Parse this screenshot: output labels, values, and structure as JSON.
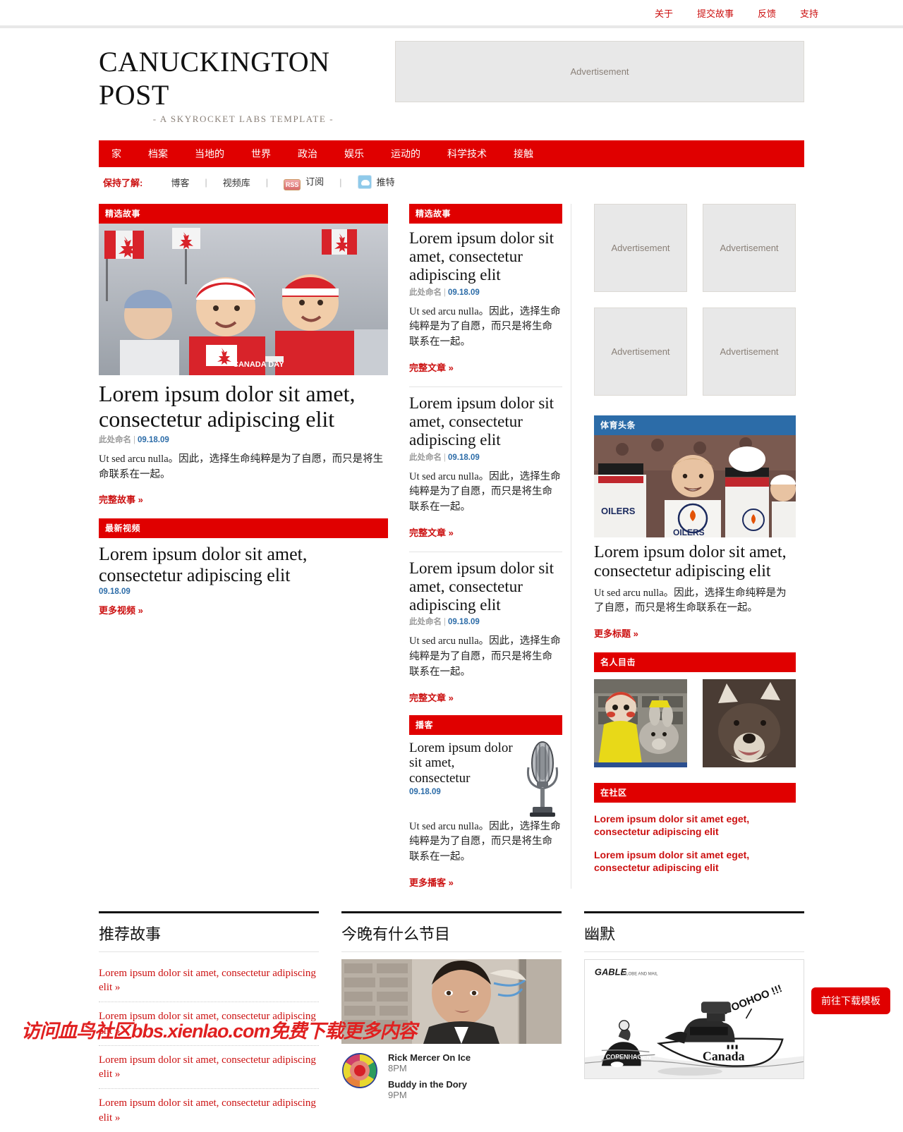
{
  "topnav": {
    "items": [
      {
        "label": "关于"
      },
      {
        "label": "提交故事"
      },
      {
        "label": "反馈"
      },
      {
        "label": "支持"
      }
    ]
  },
  "masthead": {
    "title": "CANUCKINGTON POST",
    "tagline": "- A SKYROCKET LABS TEMPLATE -",
    "banner_ad": "Advertisement"
  },
  "mainnav": {
    "items": [
      {
        "label": "家"
      },
      {
        "label": "档案"
      },
      {
        "label": "当地的"
      },
      {
        "label": "世界"
      },
      {
        "label": "政治"
      },
      {
        "label": "娱乐"
      },
      {
        "label": "运动的"
      },
      {
        "label": "科学技术"
      },
      {
        "label": "接触"
      }
    ]
  },
  "subbar": {
    "label": "保持了解:",
    "blog": "博客",
    "video_library": "视频库",
    "rss_icon_label": "RSS",
    "subscribe": "订阅",
    "twitter": "推特",
    "separator": "|"
  },
  "left": {
    "featured_header": "精选故事",
    "featured": {
      "title": "Lorem ipsum dolor sit amet, consectetur adipiscing elit",
      "author": "此处命名",
      "date": "09.18.09",
      "body": "Ut sed arcu nulla。因此，选择生命纯粹是为了自愿，而只是将生命联系在一起。",
      "more": "完整故事 »",
      "photo_alt": "canada-day-children-photo"
    },
    "video_header": "最新视频",
    "video": {
      "title": "Lorem ipsum dolor sit amet, consectetur adipiscing elit",
      "date": "09.18.09",
      "more": "更多视频 »"
    }
  },
  "middle": {
    "featured_header": "精选故事",
    "articles": [
      {
        "title": "Lorem ipsum dolor sit amet, consectetur adipiscing elit",
        "author": "此处命名",
        "date": "09.18.09",
        "body": "Ut sed arcu nulla。因此，选择生命纯粹是为了自愿，而只是将生命联系在一起。",
        "more": "完整文章 »"
      },
      {
        "title": "Lorem ipsum dolor sit amet, consectetur adipiscing elit",
        "author": "此处命名",
        "date": "09.18.09",
        "body": "Ut sed arcu nulla。因此，选择生命纯粹是为了自愿，而只是将生命联系在一起。",
        "more": "完整文章 »"
      },
      {
        "title": "Lorem ipsum dolor sit amet, consectetur adipiscing elit",
        "author": "此处命名",
        "date": "09.18.09",
        "body": "Ut sed arcu nulla。因此，选择生命纯粹是为了自愿，而只是将生命联系在一起。",
        "more": "完整文章 »"
      }
    ],
    "podcast_header": "播客",
    "podcast": {
      "title": "Lorem ipsum dolor sit amet, consectetur",
      "date": "09.18.09",
      "body": "Ut sed arcu nulla。因此，选择生命纯粹是为了自愿，而只是将生命联系在一起。",
      "more": "更多播客 »",
      "icon_alt": "microphone-image"
    }
  },
  "right": {
    "ads": [
      {
        "label": "Advertisement"
      },
      {
        "label": "Advertisement"
      },
      {
        "label": "Advertisement"
      },
      {
        "label": "Advertisement"
      }
    ],
    "sports_header": "体育头条",
    "sports": {
      "title": "Lorem ipsum dolor sit amet, consectetur adipiscing elit",
      "body": "Ut sed arcu nulla。因此，选择生命纯粹是为了自愿，而只是将生命联系在一起。",
      "more": "更多标题 »",
      "photo_alt": "hockey-celebration-photo"
    },
    "celeb_header": "名人目击",
    "celebs": [
      {
        "alt": "celebrity-photo-costumes"
      },
      {
        "alt": "celebrity-photo-dog"
      }
    ],
    "community_header": "在社区",
    "community_links": [
      {
        "label": "Lorem ipsum dolor sit amet eget, consectetur adipiscing elit"
      },
      {
        "label": "Lorem ipsum dolor sit amet eget, consectetur adipiscing elit"
      }
    ]
  },
  "footer": {
    "recommended_header": "推荐故事",
    "recommended_links": [
      {
        "label": "Lorem ipsum dolor sit amet, consectetur adipiscing elit »"
      },
      {
        "label": "Lorem ipsum dolor sit amet, consectetur adipiscing elit »"
      },
      {
        "label": "Lorem ipsum dolor sit amet, consectetur adipiscing elit »"
      },
      {
        "label": "Lorem ipsum dolor sit amet, consectetur adipiscing elit »"
      }
    ],
    "tonight_header": "今晚有什么节目",
    "tonight_photo_alt": "rick-mercer-photo",
    "tonight_logo_alt": "cbc-logo",
    "shows": [
      {
        "title": "Rick Mercer On Ice",
        "time": "8PM"
      },
      {
        "title": "Buddy in the Dory",
        "time": "9PM"
      }
    ],
    "humor_header": "幽默",
    "cartoon": {
      "alt": "editorial-cartoon",
      "signature": "GABLE",
      "speech": "WOOHOO !!!",
      "rock_label": "COPENHAGEN",
      "boat_label": "Canada"
    }
  },
  "overlay": {
    "download_button": "前往下载模板",
    "watermark": "访问血鸟社区bbs.xienlao.com免费下载更多内容"
  },
  "colors": {
    "brand_red": "#e00000",
    "link_red": "#cc1111",
    "sports_blue": "#2c6ca8",
    "ad_gray": "#e8e8e8"
  }
}
